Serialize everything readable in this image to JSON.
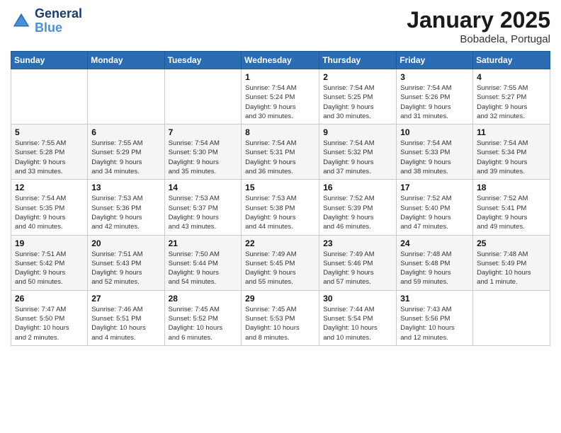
{
  "header": {
    "logo_line1": "General",
    "logo_line2": "Blue",
    "month_title": "January 2025",
    "subtitle": "Bobadela, Portugal"
  },
  "columns": [
    "Sunday",
    "Monday",
    "Tuesday",
    "Wednesday",
    "Thursday",
    "Friday",
    "Saturday"
  ],
  "weeks": [
    [
      {
        "day": "",
        "info": ""
      },
      {
        "day": "",
        "info": ""
      },
      {
        "day": "",
        "info": ""
      },
      {
        "day": "1",
        "info": "Sunrise: 7:54 AM\nSunset: 5:24 PM\nDaylight: 9 hours\nand 30 minutes."
      },
      {
        "day": "2",
        "info": "Sunrise: 7:54 AM\nSunset: 5:25 PM\nDaylight: 9 hours\nand 30 minutes."
      },
      {
        "day": "3",
        "info": "Sunrise: 7:54 AM\nSunset: 5:26 PM\nDaylight: 9 hours\nand 31 minutes."
      },
      {
        "day": "4",
        "info": "Sunrise: 7:55 AM\nSunset: 5:27 PM\nDaylight: 9 hours\nand 32 minutes."
      }
    ],
    [
      {
        "day": "5",
        "info": "Sunrise: 7:55 AM\nSunset: 5:28 PM\nDaylight: 9 hours\nand 33 minutes."
      },
      {
        "day": "6",
        "info": "Sunrise: 7:55 AM\nSunset: 5:29 PM\nDaylight: 9 hours\nand 34 minutes."
      },
      {
        "day": "7",
        "info": "Sunrise: 7:54 AM\nSunset: 5:30 PM\nDaylight: 9 hours\nand 35 minutes."
      },
      {
        "day": "8",
        "info": "Sunrise: 7:54 AM\nSunset: 5:31 PM\nDaylight: 9 hours\nand 36 minutes."
      },
      {
        "day": "9",
        "info": "Sunrise: 7:54 AM\nSunset: 5:32 PM\nDaylight: 9 hours\nand 37 minutes."
      },
      {
        "day": "10",
        "info": "Sunrise: 7:54 AM\nSunset: 5:33 PM\nDaylight: 9 hours\nand 38 minutes."
      },
      {
        "day": "11",
        "info": "Sunrise: 7:54 AM\nSunset: 5:34 PM\nDaylight: 9 hours\nand 39 minutes."
      }
    ],
    [
      {
        "day": "12",
        "info": "Sunrise: 7:54 AM\nSunset: 5:35 PM\nDaylight: 9 hours\nand 40 minutes."
      },
      {
        "day": "13",
        "info": "Sunrise: 7:53 AM\nSunset: 5:36 PM\nDaylight: 9 hours\nand 42 minutes."
      },
      {
        "day": "14",
        "info": "Sunrise: 7:53 AM\nSunset: 5:37 PM\nDaylight: 9 hours\nand 43 minutes."
      },
      {
        "day": "15",
        "info": "Sunrise: 7:53 AM\nSunset: 5:38 PM\nDaylight: 9 hours\nand 44 minutes."
      },
      {
        "day": "16",
        "info": "Sunrise: 7:52 AM\nSunset: 5:39 PM\nDaylight: 9 hours\nand 46 minutes."
      },
      {
        "day": "17",
        "info": "Sunrise: 7:52 AM\nSunset: 5:40 PM\nDaylight: 9 hours\nand 47 minutes."
      },
      {
        "day": "18",
        "info": "Sunrise: 7:52 AM\nSunset: 5:41 PM\nDaylight: 9 hours\nand 49 minutes."
      }
    ],
    [
      {
        "day": "19",
        "info": "Sunrise: 7:51 AM\nSunset: 5:42 PM\nDaylight: 9 hours\nand 50 minutes."
      },
      {
        "day": "20",
        "info": "Sunrise: 7:51 AM\nSunset: 5:43 PM\nDaylight: 9 hours\nand 52 minutes."
      },
      {
        "day": "21",
        "info": "Sunrise: 7:50 AM\nSunset: 5:44 PM\nDaylight: 9 hours\nand 54 minutes."
      },
      {
        "day": "22",
        "info": "Sunrise: 7:49 AM\nSunset: 5:45 PM\nDaylight: 9 hours\nand 55 minutes."
      },
      {
        "day": "23",
        "info": "Sunrise: 7:49 AM\nSunset: 5:46 PM\nDaylight: 9 hours\nand 57 minutes."
      },
      {
        "day": "24",
        "info": "Sunrise: 7:48 AM\nSunset: 5:48 PM\nDaylight: 9 hours\nand 59 minutes."
      },
      {
        "day": "25",
        "info": "Sunrise: 7:48 AM\nSunset: 5:49 PM\nDaylight: 10 hours\nand 1 minute."
      }
    ],
    [
      {
        "day": "26",
        "info": "Sunrise: 7:47 AM\nSunset: 5:50 PM\nDaylight: 10 hours\nand 2 minutes."
      },
      {
        "day": "27",
        "info": "Sunrise: 7:46 AM\nSunset: 5:51 PM\nDaylight: 10 hours\nand 4 minutes."
      },
      {
        "day": "28",
        "info": "Sunrise: 7:45 AM\nSunset: 5:52 PM\nDaylight: 10 hours\nand 6 minutes."
      },
      {
        "day": "29",
        "info": "Sunrise: 7:45 AM\nSunset: 5:53 PM\nDaylight: 10 hours\nand 8 minutes."
      },
      {
        "day": "30",
        "info": "Sunrise: 7:44 AM\nSunset: 5:54 PM\nDaylight: 10 hours\nand 10 minutes."
      },
      {
        "day": "31",
        "info": "Sunrise: 7:43 AM\nSunset: 5:56 PM\nDaylight: 10 hours\nand 12 minutes."
      },
      {
        "day": "",
        "info": ""
      }
    ]
  ]
}
